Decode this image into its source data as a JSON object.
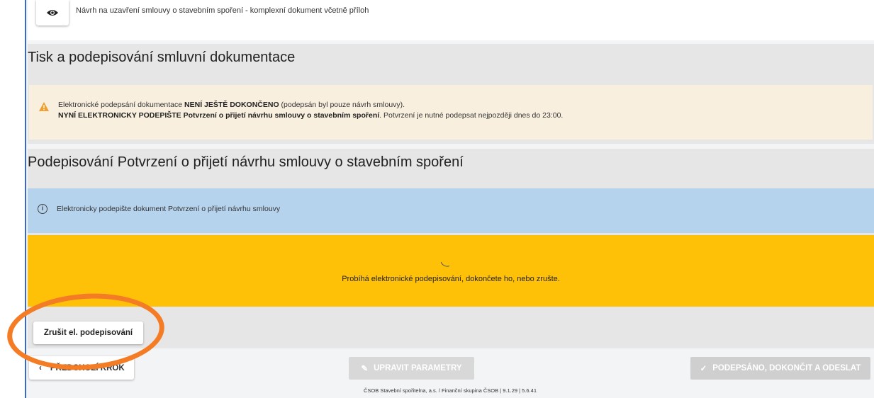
{
  "document_row": {
    "text": "Návrh na uzavření smlouvy o stavebním spoření - komplexní dokument včetně příloh",
    "icon": "eye-icon"
  },
  "print_section": {
    "title": "Tisk a podepisování smluvní dokumentace",
    "warning": {
      "icon": "warning-triangle-icon",
      "line1_prefix": "Elektronické podepsání dokumentace ",
      "line1_bold": "NENÍ JEŠTĚ DOKONČENO",
      "line1_suffix": " (podepsán byl pouze návrh smlouvy).",
      "line2_bold": "NYNÍ ELEKTRONICKY PODEPIŠTE Potvrzení o přijetí návrhu smlouvy o stavebním spoření",
      "line2_suffix": ". Potvrzení je nutné podepsat nejpozději dnes do 23:00."
    }
  },
  "sign_section": {
    "title": "Podepisování Potvrzení o přijetí návrhu smlouvy o stavebním spoření",
    "info_text": "Elektronicky podepište dokument Potvrzení o přijetí návrhu smlouvy",
    "progress_text": "Probíhá elektronické podepisování, dokončete ho, nebo zrušte.",
    "cancel_label": "Zrušit el. podepisování"
  },
  "nav": {
    "prev_label": "PŘEDCHOZÍ KROK",
    "edit_label": "UPRAVIT PARAMETRY",
    "finish_label": "PODEPSÁNO, DOKONČIT A ODESLAT"
  },
  "footer": {
    "text": "ČSOB Stavební spořitelna, a.s. / Finanční skupina ČSOB | 9.1.29 | 5.6.41"
  },
  "colors": {
    "warning_bg": "#f8efdf",
    "warning_icon": "#f0a030",
    "info_bg": "#b6d3ee",
    "progress_bg": "#ffc107",
    "highlight": "#f47c25"
  }
}
